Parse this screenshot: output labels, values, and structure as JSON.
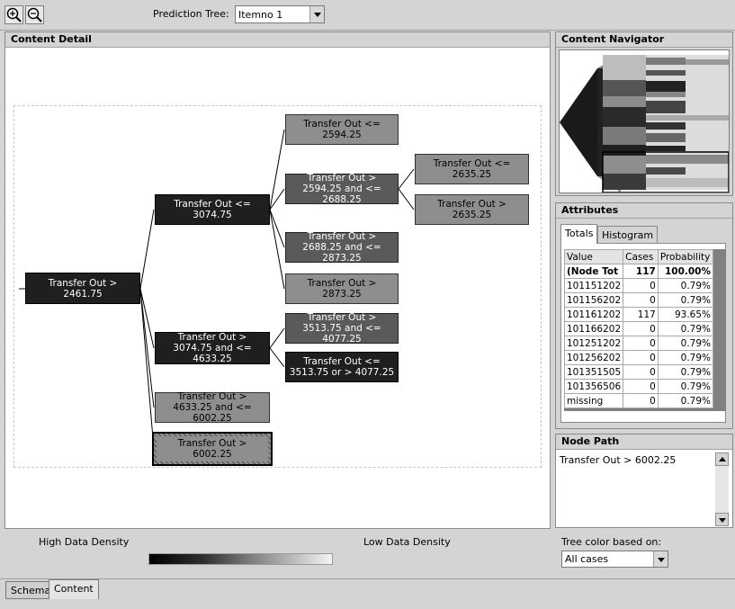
{
  "toolbar": {
    "zoom_in_icon": "zoom-in-icon",
    "zoom_out_icon": "zoom-out-icon",
    "prediction_tree_label": "Prediction Tree:",
    "prediction_tree_value": "Itemno 1"
  },
  "content_detail": {
    "title": "Content Detail",
    "nodes": {
      "root": "Transfer Out > 2461.75",
      "l1_a": "Transfer Out <= 3074.75",
      "l1_b": "Transfer Out > 3074.75 and <= 4633.25",
      "l1_c": "Transfer Out > 4633.25 and <= 6002.25",
      "l1_d": "Transfer Out > 6002.25",
      "l2_a": "Transfer Out <= 2594.25",
      "l2_b": "Transfer Out > 2594.25 and <= 2688.25",
      "l2_c": "Transfer Out > 2688.25 and <= 2873.25",
      "l2_d": "Transfer Out > 2873.25",
      "l2_e": "Transfer Out > 3513.75 and <= 4077.25",
      "l2_f": "Transfer Out <= 3513.75 or > 4077.25",
      "l3_a": "Transfer Out <= 2635.25",
      "l3_b": "Transfer Out > 2635.25"
    }
  },
  "navigator": {
    "title": "Content Navigator"
  },
  "attributes": {
    "title": "Attributes",
    "tabs": [
      "Totals",
      "Histogram"
    ],
    "columns": [
      "Value",
      "Cases",
      "Probability"
    ],
    "rows": [
      {
        "value": "(Node Tot",
        "cases": "117",
        "probability": "100.00%"
      },
      {
        "value": "101151202",
        "cases": "0",
        "probability": "0.79%"
      },
      {
        "value": "101156202",
        "cases": "0",
        "probability": "0.79%"
      },
      {
        "value": "101161202",
        "cases": "117",
        "probability": "93.65%"
      },
      {
        "value": "101166202",
        "cases": "0",
        "probability": "0.79%"
      },
      {
        "value": "101251202",
        "cases": "0",
        "probability": "0.79%"
      },
      {
        "value": "101256202",
        "cases": "0",
        "probability": "0.79%"
      },
      {
        "value": "101351505",
        "cases": "0",
        "probability": "0.79%"
      },
      {
        "value": "101356506",
        "cases": "0",
        "probability": "0.79%"
      },
      {
        "value": "missing",
        "cases": "0",
        "probability": "0.79%"
      }
    ]
  },
  "node_path": {
    "title": "Node Path",
    "text": "Transfer Out > 6002.25"
  },
  "legend": {
    "high": "High Data Density",
    "low": "Low Data Density",
    "tree_color_label": "Tree color based on:",
    "tree_color_value": "All cases"
  },
  "bottom_tabs": [
    "Schema",
    "Content"
  ]
}
